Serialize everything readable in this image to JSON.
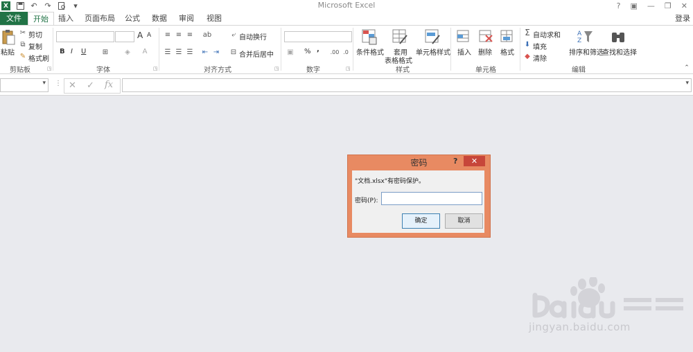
{
  "app": {
    "title": "Microsoft Excel",
    "logo_letter": "X"
  },
  "window_controls": [
    "?",
    "▣",
    "—",
    "❐",
    "✕"
  ],
  "tabs": [
    {
      "label": "文件"
    },
    {
      "label": "开始"
    },
    {
      "label": "插入"
    },
    {
      "label": "页面布局"
    },
    {
      "label": "公式"
    },
    {
      "label": "数据"
    },
    {
      "label": "审阅"
    },
    {
      "label": "视图"
    }
  ],
  "login": "登录",
  "ribbon": {
    "clipboard": {
      "paste": "粘贴",
      "cut": "剪切",
      "copy": "复制",
      "format_painter": "格式刷",
      "group": "剪贴板"
    },
    "font": {
      "bold": "B",
      "italic": "I",
      "underline": "U",
      "grow": "A",
      "shrink": "A",
      "group": "字体"
    },
    "alignment": {
      "wrap": "自动换行",
      "merge": "合并后居中",
      "group": "对齐方式"
    },
    "number": {
      "percent": "%",
      "comma": ",",
      "group": "数字"
    },
    "styles": {
      "cond_format": "条件格式",
      "table_format_1": "套用",
      "table_format_2": "表格格式",
      "cell_styles": "单元格样式",
      "group": "样式"
    },
    "cells": {
      "insert": "插入",
      "delete": "删除",
      "format": "格式",
      "group": "单元格"
    },
    "editing": {
      "autosum": "自动求和",
      "fill": "填充",
      "clear": "清除",
      "sort": "排序和筛选",
      "find": "查找和选择",
      "group": "编辑"
    }
  },
  "formula_bar": {
    "fx": "fx"
  },
  "dialog": {
    "title": "密码",
    "help": "?",
    "close": "✕",
    "message": "\"文档.xlsx\"有密码保护。",
    "password_label": "密码(P):",
    "password_value": "",
    "ok": "确定",
    "cancel": "取消"
  },
  "watermark": {
    "brand": "Bai du 经验",
    "url": "jingyan.baidu.com"
  },
  "colors": {
    "excel_green": "#217346",
    "dialog_frame": "#e88a62",
    "close_red": "#c7463a",
    "canvas": "#e9eaee"
  }
}
